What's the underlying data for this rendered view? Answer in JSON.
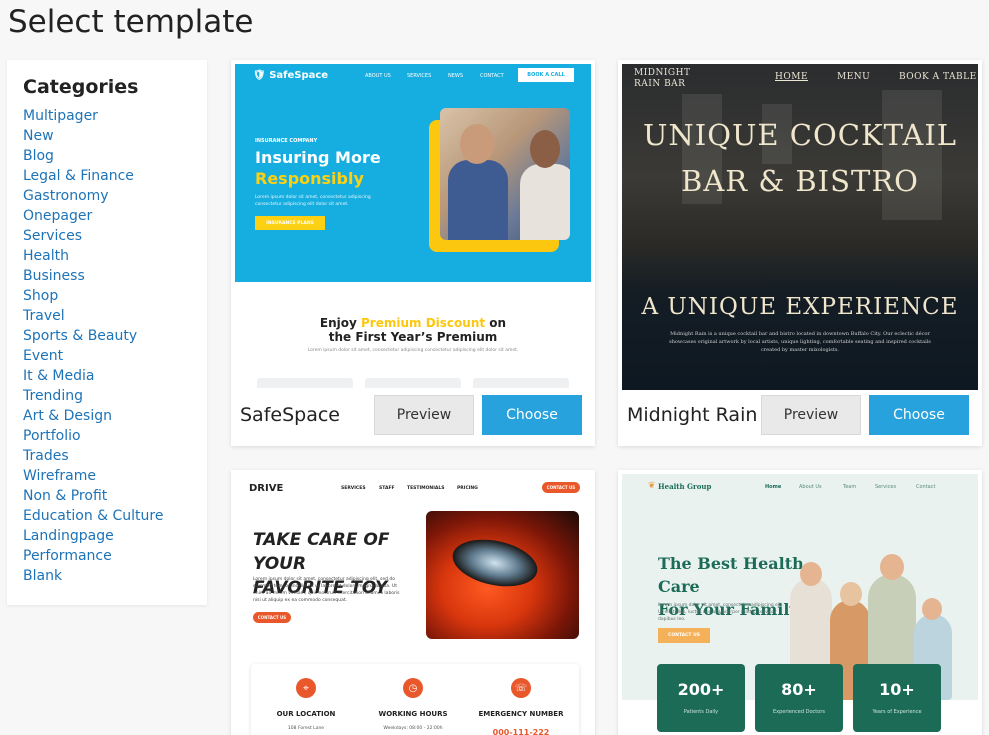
{
  "page": {
    "title": "Select template"
  },
  "categories": {
    "title": "Categories",
    "items": [
      "Multipager",
      "New",
      "Blog",
      "Legal & Finance",
      "Gastronomy",
      "Onepager",
      "Services",
      "Health",
      "Business",
      "Shop",
      "Travel",
      "Sports & Beauty",
      "Event",
      "It & Media",
      "Trending",
      "Art & Design",
      "Portfolio",
      "Trades",
      "Wireframe",
      "Non & Profit",
      "Education & Culture",
      "Landingpage",
      "Performance",
      "Blank"
    ]
  },
  "buttons": {
    "preview": "Preview",
    "choose": "Choose"
  },
  "templates": [
    {
      "name": "SafeSpace",
      "thumb": {
        "logo": "SafeSpace",
        "nav": [
          "ABOUT US",
          "SERVICES",
          "NEWS",
          "CONTACT"
        ],
        "book_call": "BOOK A CALL",
        "kicker": "INSURANCE COMPANY",
        "headline_1": "Insuring More",
        "headline_2": "Responsibly",
        "body": "Lorem ipsum dolor sit amet, consectetur adipiscing consectetur adipiscing elit dolor sit amet.",
        "cta": "INSURANCE PLANS",
        "enjoy_1": "Enjoy ",
        "enjoy_hl": "Premium Discount",
        "enjoy_2": " on",
        "enjoy_line2": "the First Year’s Premium",
        "sub": "Lorem ipsum dolor sit amet, consectetur adipiscing consectetur adipiscing elit dolor sit amet."
      }
    },
    {
      "name": "Midnight Rain",
      "thumb": {
        "logo_line1": "MIDNIGHT",
        "logo_line2": "RAIN BAR",
        "nav": [
          "HOME",
          "MENU",
          "BOOK A TABLE"
        ],
        "headline_1": "UNIQUE COCKTAIL",
        "headline_2": "BAR & BISTRO",
        "headline_3": "A UNIQUE EXPERIENCE",
        "body": "Midnight Rain is a unique cocktail bar and bistro located in downtown Buffalo City. Our eclectic décor showcases original artwork by local artists, unique lighting, comfortable seating and inspired cocktails created by master mixologists."
      }
    },
    {
      "name": "Drive",
      "thumb": {
        "logo": "DRIVE",
        "nav": [
          "SERVICES",
          "STAFF",
          "TESTIMONIALS",
          "PRICING"
        ],
        "contact": "CONTACT US",
        "headline_1": "TAKE CARE OF YOUR",
        "headline_2": "FAVORITE TOY",
        "body": "Lorem ipsum dolor sit amet, consectetur adipiscing elit, sed do eiusmod tempor incididunt ut labore et dolore magna aliqua. Ut enim ad minim veniam, quis nostrud exercitation ullamco laboris nisi ut aliquip ex ea commodo consequat.",
        "cta": "CONTACT US",
        "info": [
          {
            "label": "OUR LOCATION",
            "value": "108 Forest Lane"
          },
          {
            "label": "WORKING HOURS",
            "value": "Weekdays: 08:00 - 22:00h"
          },
          {
            "label": "EMERGENCY NUMBER",
            "value": "000-111-222"
          }
        ]
      }
    },
    {
      "name": "Health Group",
      "thumb": {
        "logo": "Health Group",
        "nav": [
          "Home",
          "About Us",
          "Team",
          "Services",
          "Contact"
        ],
        "headline_1": "The Best Health Care",
        "headline_2": "For Your Family",
        "body": "Lorem ipsum dolor sit amet, consectetur adipiscing elit. Ut elit tellus, luctus nec ullamcorper mattis, pulvinar dapibus leo.",
        "cta": "CONTACT US",
        "stats": [
          {
            "num": "200+",
            "label": "Patients Daily"
          },
          {
            "num": "80+",
            "label": "Experienced Doctors"
          },
          {
            "num": "10+",
            "label": "Years of Experience"
          }
        ]
      }
    }
  ],
  "colors": {
    "link": "#1e73b7",
    "choose_bg": "#27a2dc",
    "safespace_blue": "#16aee0",
    "safespace_yellow": "#fcd013",
    "drive_orange": "#e8582b",
    "health_green": "#1b6b57"
  }
}
